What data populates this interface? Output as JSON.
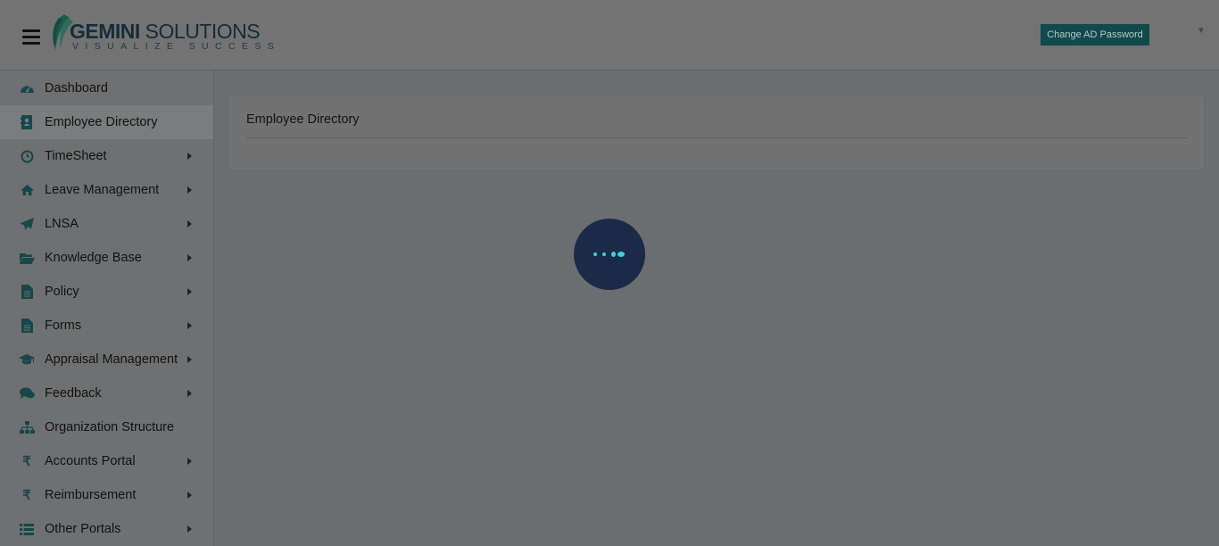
{
  "brand": {
    "name_part1": "GEMINI",
    "name_part2": "SOLUTIONS",
    "tagline": "VISUALIZE SUCCESS",
    "accent_color": "#12494d"
  },
  "header": {
    "change_password_label": "Change AD Password",
    "user_menu_icon": "caret-down-icon"
  },
  "sidebar": {
    "items": [
      {
        "label": "Dashboard",
        "icon": "tachometer-icon",
        "submenu": false
      },
      {
        "label": "Employee Directory",
        "icon": "address-book-icon",
        "submenu": false,
        "active": true
      },
      {
        "label": "TimeSheet",
        "icon": "clock-icon",
        "submenu": true
      },
      {
        "label": "Leave Management",
        "icon": "home-icon",
        "submenu": true
      },
      {
        "label": "LNSA",
        "icon": "paper-plane-icon",
        "submenu": true
      },
      {
        "label": "Knowledge Base",
        "icon": "folder-open-icon",
        "submenu": true
      },
      {
        "label": "Policy",
        "icon": "file-text-icon",
        "submenu": true
      },
      {
        "label": "Forms",
        "icon": "file-text-icon",
        "submenu": true
      },
      {
        "label": "Appraisal Management",
        "icon": "graduation-cap-icon",
        "submenu": true
      },
      {
        "label": "Feedback",
        "icon": "comments-icon",
        "submenu": true
      },
      {
        "label": "Organization Structure",
        "icon": "sitemap-icon",
        "submenu": false
      },
      {
        "label": "Accounts Portal",
        "icon": "rupee-icon",
        "submenu": true
      },
      {
        "label": "Reimbursement",
        "icon": "rupee-icon",
        "submenu": true
      },
      {
        "label": "Other Portals",
        "icon": "list-icon",
        "submenu": true
      }
    ]
  },
  "main": {
    "panel_title": "Employee Directory"
  },
  "loader": {
    "icon": "loading-dots-icon"
  }
}
